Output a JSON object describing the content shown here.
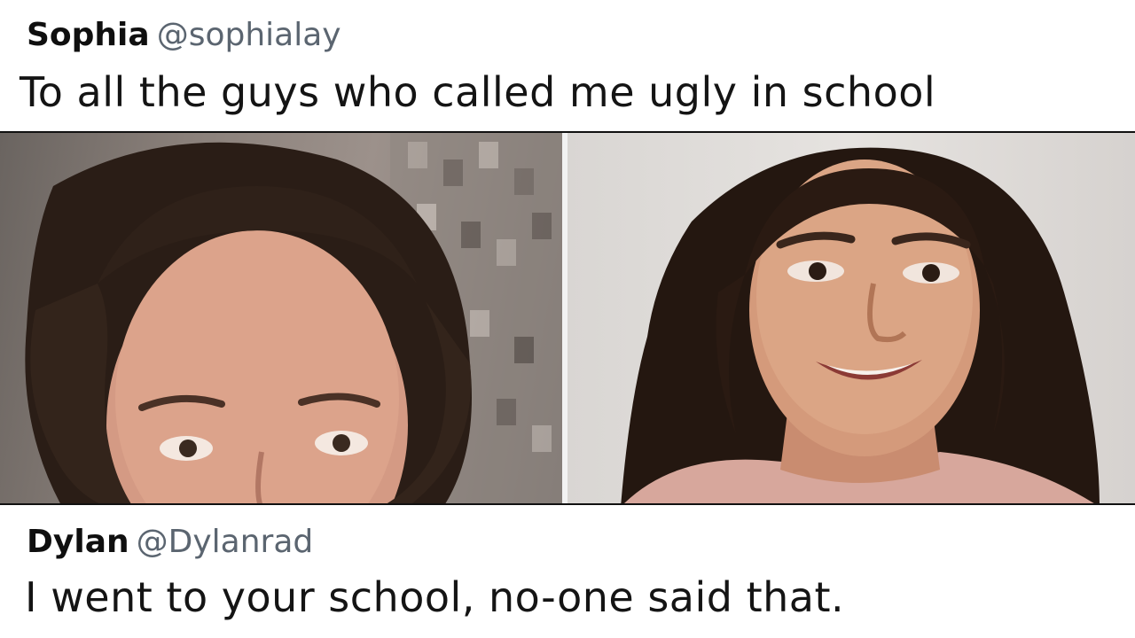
{
  "tweets": [
    {
      "display_name": "Sophia",
      "handle": "@sophialay",
      "text": "To all the guys who called me ugly in school"
    },
    {
      "display_name": "Dylan",
      "handle": "@Dylanrad",
      "text": "I went to your school, no-one said that."
    }
  ],
  "photos": [
    {
      "icon": "before-photo-portrait"
    },
    {
      "icon": "after-photo-portrait"
    }
  ],
  "colors": {
    "text": "#141414",
    "handle": "#5b6570",
    "background": "#ffffff"
  }
}
